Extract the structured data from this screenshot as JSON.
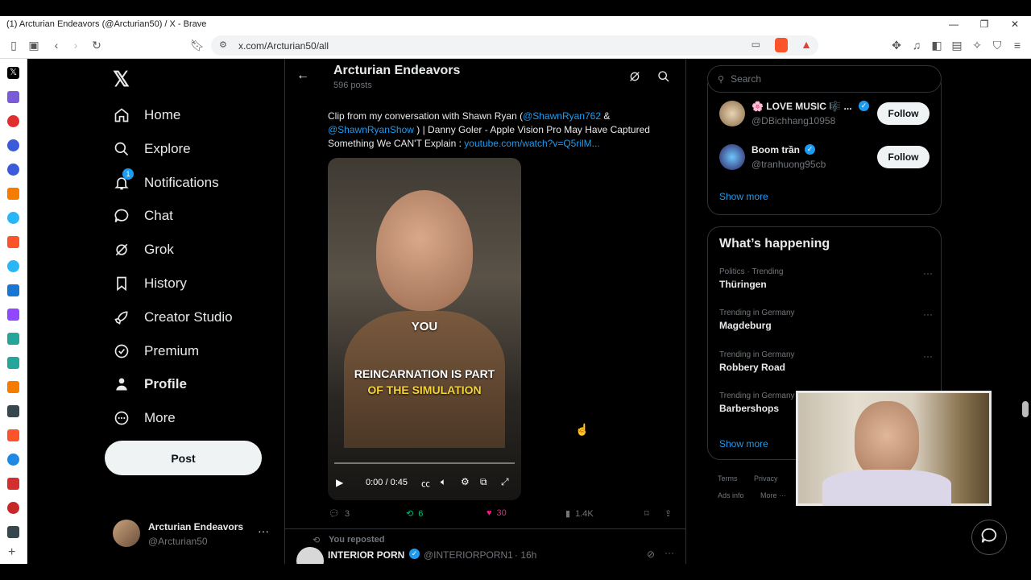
{
  "window": {
    "title": "(1) Arcturian Endeavors (@Arcturian50) / X - Brave"
  },
  "browser": {
    "url": "x.com/Arcturian50/all"
  },
  "nav": {
    "items": [
      {
        "label": "Home",
        "icon": "home-icon"
      },
      {
        "label": "Explore",
        "icon": "search-icon"
      },
      {
        "label": "Notifications",
        "icon": "bell-icon",
        "badge": "1"
      },
      {
        "label": "Chat",
        "icon": "chat-icon"
      },
      {
        "label": "Grok",
        "icon": "grok-icon"
      },
      {
        "label": "History",
        "icon": "bookmark-icon"
      },
      {
        "label": "Creator Studio",
        "icon": "rocket-icon"
      },
      {
        "label": "Premium",
        "icon": "verified-badge-icon"
      },
      {
        "label": "Profile",
        "icon": "person-icon"
      },
      {
        "label": "More",
        "icon": "more-circle-icon"
      }
    ],
    "post_label": "Post",
    "account": {
      "name": "Arcturian Endeavors",
      "handle": "@Arcturian50"
    }
  },
  "header": {
    "title": "Arcturian Endeavors",
    "subtitle": "596 posts"
  },
  "tweet": {
    "text_a": "Clip from my conversation with Shawn Ryan (",
    "mention1": "@ShawnRyan762",
    "text_b": " &",
    "mention2": "@ShawnRyanShow",
    "text_c": " ) | Danny Goler - Apple Vision Pro May Have Captured Something We CAN'T Explain : ",
    "link": "youtube.com/watch?v=Q5rilM...",
    "video": {
      "caption1": "YOU",
      "caption2": "REINCARNATION IS PART",
      "caption3": "OF THE SIMULATION",
      "time": "0:00 / 0:45"
    },
    "replies": "3",
    "reposts": "6",
    "likes": "30",
    "views": "1.4K"
  },
  "next_tweet": {
    "context": "You reposted",
    "name": "INTERIOR PORN",
    "handle": "@INTERIORPORN1",
    "time": "· 16h"
  },
  "search": {
    "placeholder": "Search"
  },
  "who_to_follow": {
    "accounts": [
      {
        "name": "🌸 LOVE MUSIC 🎼 ...",
        "handle": "@DBichhang10958",
        "button": "Follow"
      },
      {
        "name": "Boom trần",
        "handle": "@tranhuong95cb",
        "button": "Follow"
      }
    ],
    "show_more": "Show more"
  },
  "trends": {
    "title": "What’s happening",
    "items": [
      {
        "category": "Politics · Trending",
        "name": "Thüringen"
      },
      {
        "category": "Trending in Germany",
        "name": "Magdeburg"
      },
      {
        "category": "Trending in Germany",
        "name": "Robbery Road"
      },
      {
        "category": "Trending in Germany",
        "name": "Barbershops"
      }
    ],
    "show_more": "Show more"
  },
  "footer": {
    "terms": "Terms",
    "privacy": "Privacy",
    "ads": "Ads info",
    "more": "More ···"
  },
  "colors": {
    "accent": "#1d9bf0",
    "like": "#f91880",
    "repost": "#00ba7c",
    "bg": "#000000",
    "border": "#2f3336"
  }
}
